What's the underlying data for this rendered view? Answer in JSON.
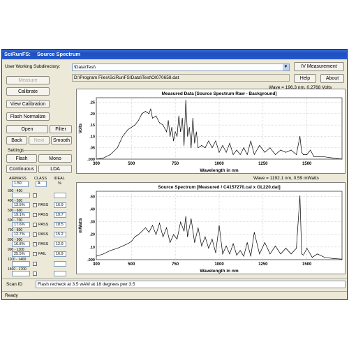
{
  "window": {
    "app_title": "SciRunFS:",
    "doc_title": "Source Spectrum"
  },
  "header": {
    "subdir_label": "User Working Subdirectory:",
    "subdir_value": "\\Data\\Test\\",
    "filepath": "D:\\Program Files\\SciRunFS\\Data\\Test\\OI070658.dat",
    "iv_button": "IV Measurement",
    "help_button": "Help",
    "about_button": "About"
  },
  "left_panel": {
    "measure": "Measure",
    "calibrate": "Calibrate",
    "view_calibration": "View Calibration",
    "flash_normalize": "Flash Normalize",
    "open": "Open",
    "filter": "Filter",
    "back": "Back",
    "next": "Next",
    "smooth": "Smooth",
    "settings_label": "Settings",
    "flash": "Flash",
    "mono": "Mono",
    "continuous": "Continuous",
    "lda": "LDA"
  },
  "airmass_table": {
    "headers": [
      "AIRMASS",
      "CLASS",
      "IDEAL"
    ],
    "airmass_value": "1.50",
    "class_value": "A",
    "pct": "%",
    "rows": [
      {
        "range": "300 - 400",
        "unit": "%",
        "measured": "",
        "class": "",
        "ideal": ""
      },
      {
        "range": "400 - 500",
        "unit": "",
        "measured": "13.5%",
        "class": "PASS",
        "ideal": "16.9"
      },
      {
        "range": "500 - 600",
        "unit": "",
        "measured": "19.1%",
        "class": "PASS",
        "ideal": "19.7"
      },
      {
        "range": "600 - 700",
        "unit": "",
        "measured": "17.6%",
        "class": "PASS",
        "ideal": "18.5"
      },
      {
        "range": "700 - 800",
        "unit": "",
        "measured": "12.7%",
        "class": "PASS",
        "ideal": "15.2"
      },
      {
        "range": "800 - 900",
        "unit": "",
        "measured": "16.8%",
        "class": "PASS",
        "ideal": "12.9"
      },
      {
        "range": "900 - 1100",
        "unit": "",
        "measured": "25.5%",
        "class": "FAIL",
        "ideal": "16.9"
      },
      {
        "range": "1100 - 1400",
        "unit": "%",
        "measured": "",
        "class": "",
        "ideal": ""
      },
      {
        "range": "1400 - 1700",
        "unit": "%",
        "measured": "",
        "class": "",
        "ideal": ""
      }
    ]
  },
  "readout_top": "Wave = 196.3 nm,  0.2768 Volts",
  "readout_bottom": "Wave = 1192.1 nm,  0.59 mWatts",
  "scan_id_label": "Scan ID",
  "scan_id_value": "Flash recheck at 3.5 wAM at 18 degrees pwr 3.5",
  "status": "Ready",
  "chart_data": [
    {
      "type": "line",
      "title": "Measured Data  [Source Spectrum Raw - Background]",
      "xlabel": "Wavelength in nm",
      "ylabel": "Volts",
      "xlim": [
        300,
        1700
      ],
      "ylim": [
        0,
        0.27
      ],
      "xticks": [
        "300",
        "500",
        "750",
        "1000",
        "1250",
        "1500"
      ],
      "yticks": [
        ".000",
        ".05",
        ".10",
        ".15",
        ".20",
        ".25"
      ],
      "grid": true,
      "series": [
        {
          "x": [
            300,
            340,
            380,
            420,
            450,
            480,
            500,
            520,
            540,
            560,
            580,
            600,
            610,
            620,
            640,
            660,
            680,
            700,
            710,
            720,
            730,
            740,
            750,
            760,
            770,
            780,
            790,
            800,
            810,
            820,
            830,
            840,
            850,
            860,
            870,
            880,
            900,
            920,
            940,
            960,
            980,
            1000,
            1020,
            1040,
            1060,
            1080,
            1100,
            1120,
            1140,
            1160,
            1180,
            1200,
            1230,
            1260,
            1290,
            1320,
            1350,
            1380,
            1410,
            1440,
            1460,
            1470,
            1480,
            1500,
            1520,
            1540,
            1560,
            1600,
            1650,
            1700
          ],
          "y": [
            0.0,
            0.005,
            0.02,
            0.05,
            0.1,
            0.13,
            0.14,
            0.15,
            0.17,
            0.2,
            0.21,
            0.2,
            0.22,
            0.18,
            0.19,
            0.16,
            0.15,
            0.12,
            0.17,
            0.1,
            0.14,
            0.08,
            0.12,
            0.1,
            0.19,
            0.12,
            0.18,
            0.06,
            0.26,
            0.1,
            0.14,
            0.05,
            0.18,
            0.07,
            0.12,
            0.05,
            0.06,
            0.05,
            0.08,
            0.05,
            0.08,
            0.03,
            0.06,
            0.03,
            0.07,
            0.02,
            0.04,
            0.02,
            0.05,
            0.02,
            0.08,
            0.02,
            0.06,
            0.03,
            0.05,
            0.02,
            0.04,
            0.03,
            0.04,
            0.02,
            0.1,
            0.03,
            0.02,
            0.02,
            0.04,
            0.01,
            0.01,
            0.01,
            0.005,
            0.0
          ]
        }
      ]
    },
    {
      "type": "line",
      "title": "Source Spectrum [Measured / C4157270.cal x OL220.dat]",
      "xlabel": "Wavelength in nm",
      "ylabel": "mWatts",
      "xlim": [
        300,
        1700
      ],
      "ylim": [
        0,
        0.6
      ],
      "xticks": [
        "300",
        "500",
        "750",
        "1000",
        "1250",
        "1500"
      ],
      "yticks": [
        ".000",
        ".10",
        ".20",
        ".30",
        ".40",
        ".50"
      ],
      "grid": true,
      "series": [
        {
          "x": [
            300,
            340,
            380,
            420,
            450,
            480,
            500,
            520,
            540,
            560,
            580,
            600,
            620,
            640,
            660,
            680,
            700,
            720,
            740,
            760,
            780,
            800,
            810,
            820,
            840,
            860,
            880,
            900,
            920,
            940,
            960,
            980,
            1000,
            1020,
            1040,
            1060,
            1080,
            1100,
            1120,
            1140,
            1160,
            1180,
            1200,
            1230,
            1260,
            1290,
            1320,
            1350,
            1380,
            1410,
            1440,
            1460,
            1470,
            1480,
            1500,
            1530,
            1560,
            1600,
            1650,
            1700
          ],
          "y": [
            0.03,
            0.05,
            0.08,
            0.1,
            0.12,
            0.14,
            0.16,
            0.2,
            0.22,
            0.25,
            0.28,
            0.24,
            0.3,
            0.22,
            0.32,
            0.2,
            0.28,
            0.15,
            0.22,
            0.18,
            0.33,
            0.25,
            0.38,
            0.2,
            0.36,
            0.15,
            0.28,
            0.12,
            0.2,
            0.1,
            0.18,
            0.06,
            0.3,
            0.05,
            0.12,
            0.05,
            0.14,
            0.04,
            0.08,
            0.03,
            0.15,
            0.03,
            0.24,
            0.05,
            0.15,
            0.05,
            0.12,
            0.05,
            0.1,
            0.05,
            0.1,
            0.56,
            0.05,
            0.04,
            0.1,
            0.02,
            0.05,
            0.02,
            0.01,
            0.005
          ]
        }
      ]
    }
  ]
}
